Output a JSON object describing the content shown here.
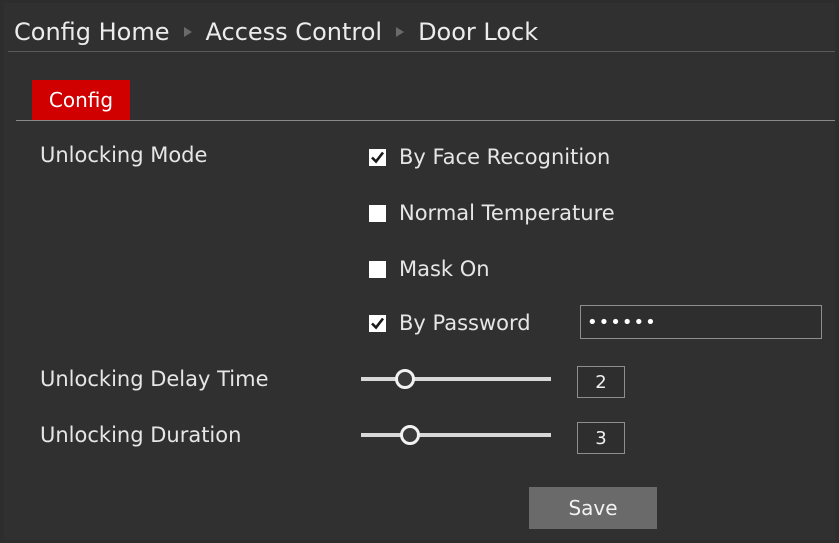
{
  "breadcrumb": {
    "items": [
      "Config Home",
      "Access Control",
      "Door Lock"
    ]
  },
  "tabs": [
    {
      "label": "Config",
      "active": true
    }
  ],
  "form": {
    "unlocking_mode_label": "Unlocking Mode",
    "options": [
      {
        "label": "By Face Recognition",
        "checked": true
      },
      {
        "label": "Normal Temperature",
        "checked": false
      },
      {
        "label": "Mask On",
        "checked": false
      },
      {
        "label": "By Password",
        "checked": true
      }
    ],
    "password_value": "••••••",
    "delay_label": "Unlocking Delay Time",
    "delay_value": "2",
    "delay_fraction": 0.23,
    "duration_label": "Unlocking Duration",
    "duration_value": "3",
    "duration_fraction": 0.26,
    "save_label": "Save"
  },
  "colors": {
    "accent": "#d10000",
    "background": "#303030"
  }
}
